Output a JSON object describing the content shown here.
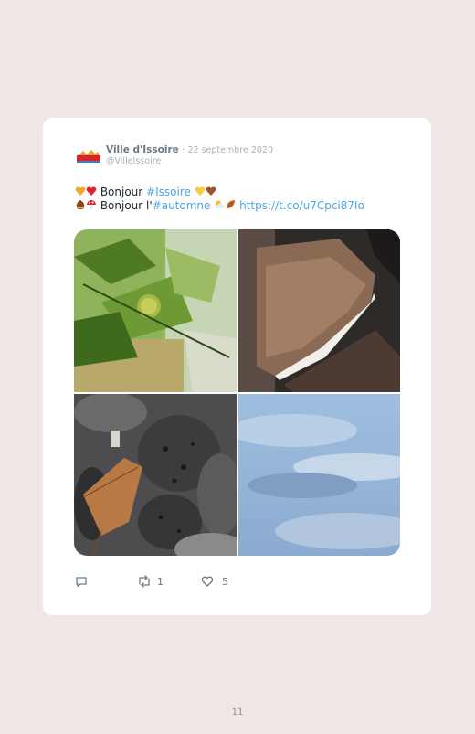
{
  "tweet": {
    "author_name": "Ville d'Issoire",
    "separator": "·",
    "date": "22 septembre 2020",
    "handle": "@VilleIssoire",
    "line1": {
      "emojis_before": [
        "orange-heart",
        "red-heart"
      ],
      "text": "Bonjour ",
      "hashtag": "#Issoire",
      "emojis_after": [
        "yellow-heart",
        "brown-heart"
      ]
    },
    "line2": {
      "emojis_before": [
        "chestnut",
        "mushroom"
      ],
      "text": "Bonjour l'",
      "hashtag": "#automne",
      "emojis_after": [
        "sun-behind-cloud",
        "fallen-leaf"
      ],
      "link": "https://t.co/u7Cpci87Io"
    },
    "photos": [
      {
        "subject": "chestnut-tree-photo"
      },
      {
        "subject": "bracket-fungus-photo"
      },
      {
        "subject": "stones-and-leaf-photo"
      },
      {
        "subject": "sky-photo"
      }
    ],
    "actions": {
      "reply_icon": "reply-icon",
      "retweet_icon": "retweet-icon",
      "retweet_count": "1",
      "like_icon": "heart-icon",
      "like_count": "5"
    }
  },
  "page_number": "11",
  "colors": {
    "background": "#efe8e6",
    "card": "#ffffff",
    "link": "#4ba5e6",
    "muted": "#a7b1bb"
  }
}
